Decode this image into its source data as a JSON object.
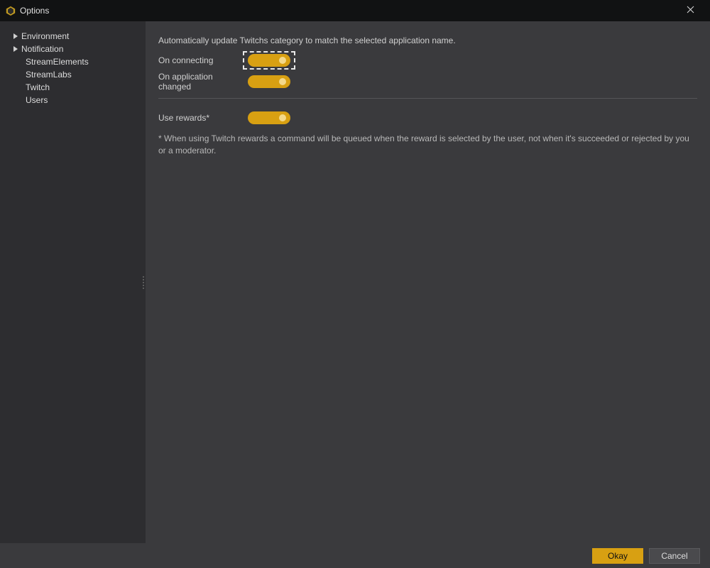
{
  "window": {
    "title": "Options"
  },
  "sidebar": {
    "items": [
      {
        "label": "Environment",
        "expandable": true
      },
      {
        "label": "Notification",
        "expandable": true
      },
      {
        "label": "StreamElements",
        "expandable": false
      },
      {
        "label": "StreamLabs",
        "expandable": false
      },
      {
        "label": "Twitch",
        "expandable": false
      },
      {
        "label": "Users",
        "expandable": false
      }
    ]
  },
  "content": {
    "description": "Automatically update Twitchs category to match the selected application name.",
    "rows": [
      {
        "label": "On connecting",
        "toggle_on": true,
        "highlighted": true
      },
      {
        "label": "On application changed",
        "toggle_on": true,
        "highlighted": false
      }
    ],
    "reward_label": "Use rewards*",
    "reward_toggle_on": true,
    "footnote": "* When using Twitch rewards a command will be queued when the reward is selected by the user, not when it's succeeded or rejected by you or a moderator."
  },
  "footer": {
    "ok": "Okay",
    "cancel": "Cancel"
  },
  "colors": {
    "accent": "#d8a012"
  }
}
